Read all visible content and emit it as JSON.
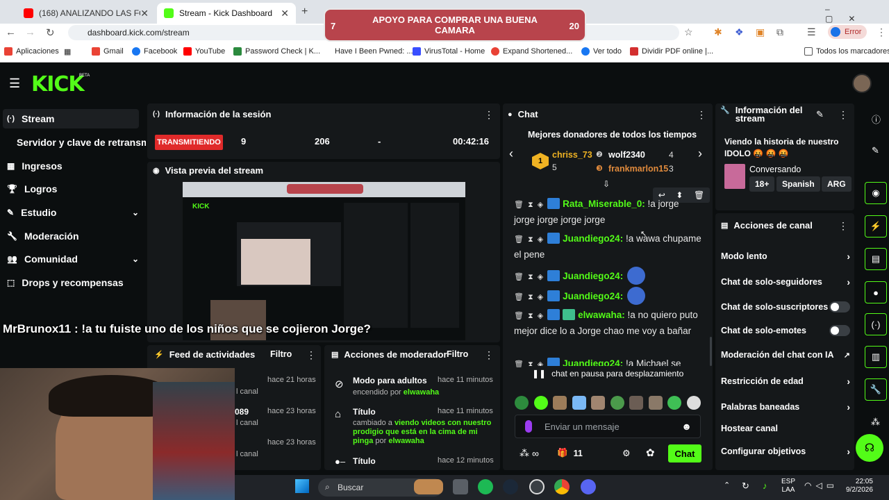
{
  "browser": {
    "tabs": [
      {
        "title": "(168) ANALIZANDO LAS FOTOS",
        "color": "#ff0000"
      },
      {
        "title": "Stream - Kick Dashboard",
        "color": "#53fc18"
      }
    ],
    "url": "dashboard.kick.com/stream",
    "profile_label": "Error",
    "bookmarks": [
      "Aplicaciones",
      "Gmail",
      "Facebook",
      "YouTube",
      "Password Check | K...",
      "Have I Been Pwned: ...",
      "VirusTotal - Home",
      "Expand Shortened...",
      "Ver todo",
      "Dividir PDF online |...",
      "Todos los marcadores"
    ]
  },
  "goal": {
    "text": "APOYO PARA COMPRAR UNA BUENA CAMARA",
    "current": "7",
    "target": "20"
  },
  "sidebar": {
    "items": [
      {
        "label": "Stream",
        "icon": "stream-icon",
        "glyph": "(·)"
      },
      {
        "label": "Servidor y clave de retransmisión",
        "icon": "",
        "glyph": ""
      },
      {
        "label": "Ingresos",
        "icon": "ingresos-icon",
        "glyph": "▦"
      },
      {
        "label": "Logros",
        "icon": "trophy-icon",
        "glyph": "🏆"
      },
      {
        "label": "Estudio",
        "icon": "studio-icon",
        "glyph": "✎"
      },
      {
        "label": "Moderación",
        "icon": "wrench-icon",
        "glyph": "🔧"
      },
      {
        "label": "Comunidad",
        "icon": "community-icon",
        "glyph": "👥"
      },
      {
        "label": "Drops y recompensas",
        "icon": "drops-icon",
        "glyph": "⬚"
      }
    ]
  },
  "session": {
    "title": "Información de la sesión",
    "status": "TRANSMITIENDO",
    "viewers": "9",
    "followers": "206",
    "subs": "-",
    "duration": "00:42:16"
  },
  "preview": {
    "title": "Vista previa del stream"
  },
  "feed": {
    "title": "Feed de actividades",
    "filter": "Filtro",
    "items": [
      {
        "time": "hace 21 horas",
        "sub": "l canal",
        "name": ""
      },
      {
        "time": "hace 23 horas",
        "sub": "l canal",
        "name": "089"
      },
      {
        "time": "hace 23 horas",
        "sub": "l canal",
        "name": ""
      }
    ]
  },
  "modactions": {
    "title": "Acciones de moderador",
    "filter": "Filtro",
    "items": [
      {
        "title": "Modo para adultos",
        "time": "hace 11 minutos",
        "desc_pre": "encendido por",
        "user": "elwawaha",
        "desc_mid": "",
        "tail": ""
      },
      {
        "title": "Título",
        "time": "hace 11 minutos",
        "desc_pre": "cambiado a",
        "quote": "viendo videos con nuestro prodigio que está en la cima de mi pinga",
        "tail": "por",
        "user": "elwawaha"
      },
      {
        "title": "Título",
        "time": "hace 12 minutos"
      }
    ]
  },
  "chat": {
    "title": "Chat",
    "donors_title": "Mejores donadores de todos los tiempos",
    "donors": [
      {
        "rank": "1",
        "name": "chriss_73",
        "amount": "5"
      },
      {
        "rank": "2",
        "name": "wolf2340",
        "amount": "4"
      },
      {
        "rank": "3",
        "name": "frankmarlon15",
        "amount": "3"
      }
    ],
    "messages": [
      {
        "user": "Rata_Miserable_0:",
        "text": "!a jorge jorge jorge jorge jorge",
        "color": "#53fc18"
      },
      {
        "user": "Juandiego24:",
        "text": "!a wawa chupame el pene",
        "color": "#53fc18"
      },
      {
        "user": "Juandiego24:",
        "text": "",
        "color": "#53fc18"
      },
      {
        "user": "Juandiego24:",
        "text": "",
        "color": "#53fc18"
      },
      {
        "user": "elwawaha:",
        "text": "!a no quiero puto mejor dice lo a Jorge chao me voy a bañar",
        "color": "#53fc18"
      },
      {
        "user": "Juandiego24:",
        "text": "!a Michael se",
        "color": "#53fc18"
      }
    ],
    "paused": "chat en pausa para desplazamiento",
    "input_placeholder": "Enviar un mensaje",
    "count_infinite": "∞",
    "gift_count": "11",
    "send_label": "Chat"
  },
  "stream_info": {
    "title": "Información del stream",
    "stream_title": "Viendo la historia de nuestro IDOLO 🤬 🤬 🤬",
    "category": "Conversando",
    "tags": [
      "18+",
      "Spanish",
      "ARG"
    ]
  },
  "channel_actions": {
    "title": "Acciones de canal",
    "items": [
      {
        "label": "Modo lento",
        "kind": "chevron"
      },
      {
        "label": "Chat de solo-seguidores",
        "kind": "chevron"
      },
      {
        "label": "Chat de solo-suscriptores",
        "kind": "toggle"
      },
      {
        "label": "Chat de solo-emotes",
        "kind": "toggle"
      },
      {
        "label": "Moderación del chat con IA",
        "kind": "external"
      },
      {
        "label": "Restricción de edad",
        "kind": "chevron"
      },
      {
        "label": "Palabras baneadas",
        "kind": "chevron"
      },
      {
        "label": "Hostear canal",
        "kind": "none"
      },
      {
        "label": "Configurar objetivos",
        "kind": "chevron"
      }
    ]
  },
  "overlay": {
    "text": "MrBrunox11 : !a tu fuiste uno de los niños que se cojieron Jorge?"
  },
  "taskbar": {
    "search": "Buscar",
    "lang": "ESP",
    "lang2": "LAA",
    "time": "22:05",
    "date": "9/2/2026"
  }
}
